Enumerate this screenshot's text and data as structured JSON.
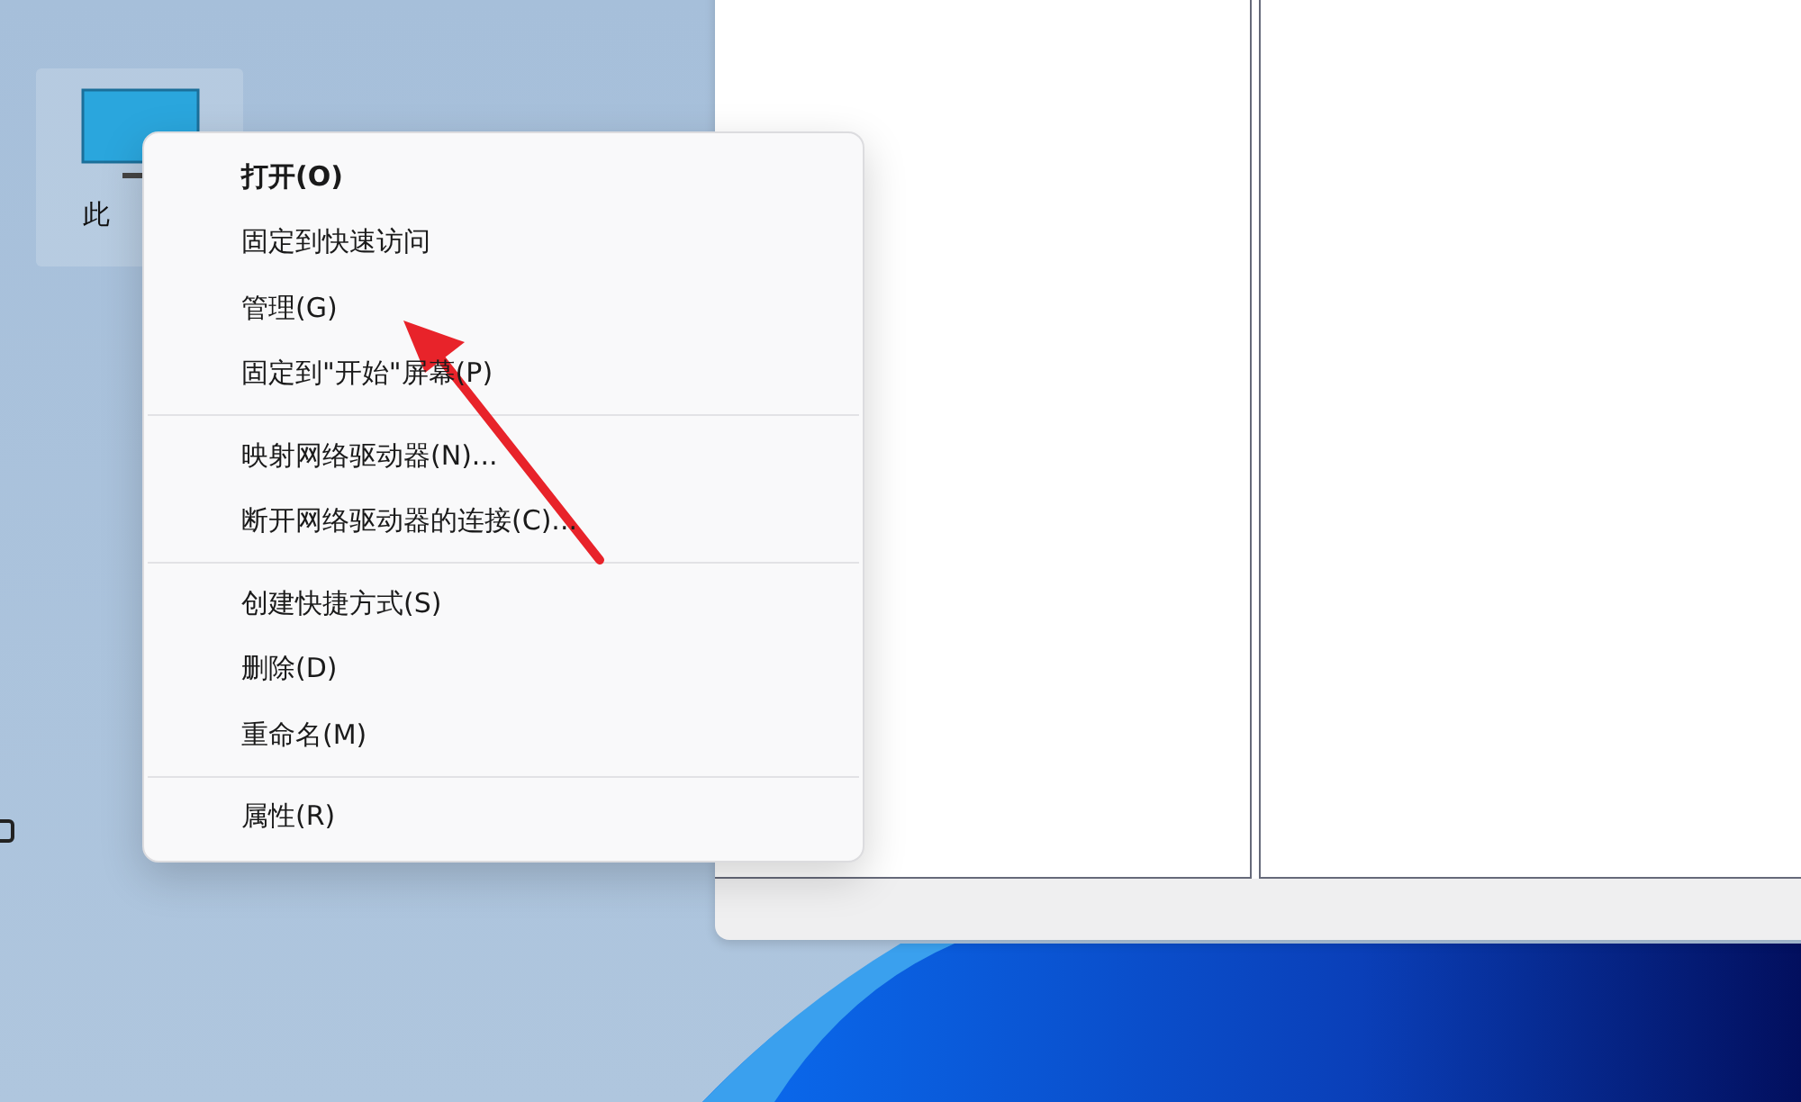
{
  "desktop_icons": [
    {
      "label": "此",
      "selected": true
    }
  ],
  "context_menu": {
    "sections": [
      [
        {
          "label": "打开(O)",
          "default": true
        },
        {
          "label": "固定到快速访问",
          "default": false
        },
        {
          "label": "管理(G)",
          "default": false
        },
        {
          "label": "固定到\"开始\"屏幕(P)",
          "default": false
        }
      ],
      [
        {
          "label": "映射网络驱动器(N)...",
          "default": false
        },
        {
          "label": "断开网络驱动器的连接(C)...",
          "default": false
        }
      ],
      [
        {
          "label": "创建快捷方式(S)",
          "default": false
        },
        {
          "label": "删除(D)",
          "default": false
        },
        {
          "label": "重命名(M)",
          "default": false
        }
      ],
      [
        {
          "label": "属性(R)",
          "default": false
        }
      ]
    ]
  }
}
